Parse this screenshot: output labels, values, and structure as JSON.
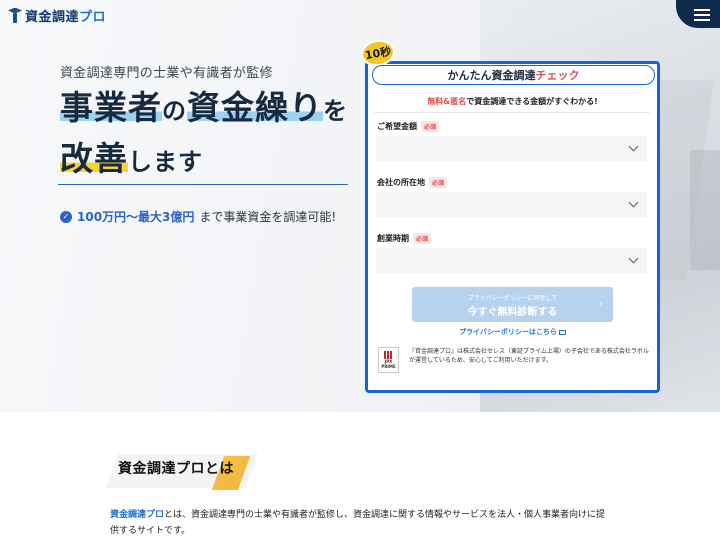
{
  "header": {
    "logo_main": "資金調達",
    "logo_accent": "プロ",
    "menu_icon": "hamburger-icon"
  },
  "hero": {
    "subtitle": "資金調達専門の士業や有識者が監修",
    "headline": {
      "w1": "事業者",
      "w2": "の",
      "w3": "資金繰り",
      "w4": "を",
      "w5": "改善",
      "w6": "します"
    },
    "range_highlight": "100万円〜最大3億円",
    "range_rest": "まで事業資金を調達可能!"
  },
  "form": {
    "badge": "10秒",
    "title_main": "かんたん資金調達",
    "title_accent": "チェック",
    "lead_accent": "無料&匿名",
    "lead_rest": "で資金調達できる金額がすぐわかる!",
    "fields": [
      {
        "label": "ご希望金額",
        "required": "必須"
      },
      {
        "label": "会社の所在地",
        "required": "必須"
      },
      {
        "label": "創業時期",
        "required": "必須"
      }
    ],
    "submit_small": "プライバシーポリシーに同意して",
    "submit_main": "今すぐ無料診断する",
    "submit_arrow": "›",
    "privacy_link": "プライバシーポリシーはこちら",
    "jpx_label": "JPX",
    "jpx_sub": "PRIME",
    "note": "『資金調達プロ』は株式会社セレス（東証プライム上場）の子会社である株式会社ラボルが運営しているため、安心してご利用いただけます。"
  },
  "about": {
    "title": "資金調達プロとは",
    "brand": "資金調達プロ",
    "text": "とは、資金調達専門の士業や有識者が監修し、資金調達に関する情報やサービスを法人・個人事業者向けに提供するサイトです。"
  }
}
